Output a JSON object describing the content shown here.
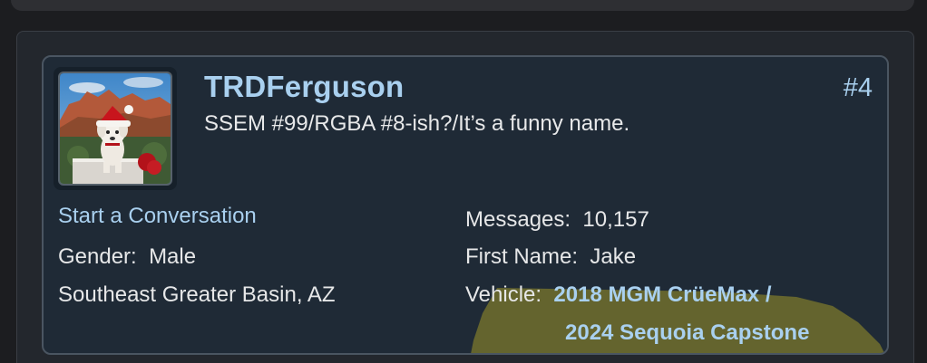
{
  "member": {
    "username": "TRDFerguson",
    "user_title": "SSEM #99/RGBA #8-ish?/It’s a funny name.",
    "post_number": "#4",
    "start_conversation": "Start a Conversation",
    "gender_label": "Gender:",
    "gender_value": "Male",
    "location": "Southeast Greater Basin, AZ",
    "messages_label": "Messages:",
    "messages_value": "10,157",
    "first_name_label": "First Name:",
    "first_name_value": "Jake",
    "vehicle_label": "Vehicle:",
    "vehicle_line1": "2018 MGM CrüeMax /",
    "vehicle_line2": "2024 Sequoia Capstone"
  },
  "colors": {
    "accent": "#a9d0ef",
    "card_bg": "#1f2a36",
    "highlight": "#6b6a2e"
  },
  "icons": {
    "avatar": "dog-in-santa-hat-avatar"
  }
}
